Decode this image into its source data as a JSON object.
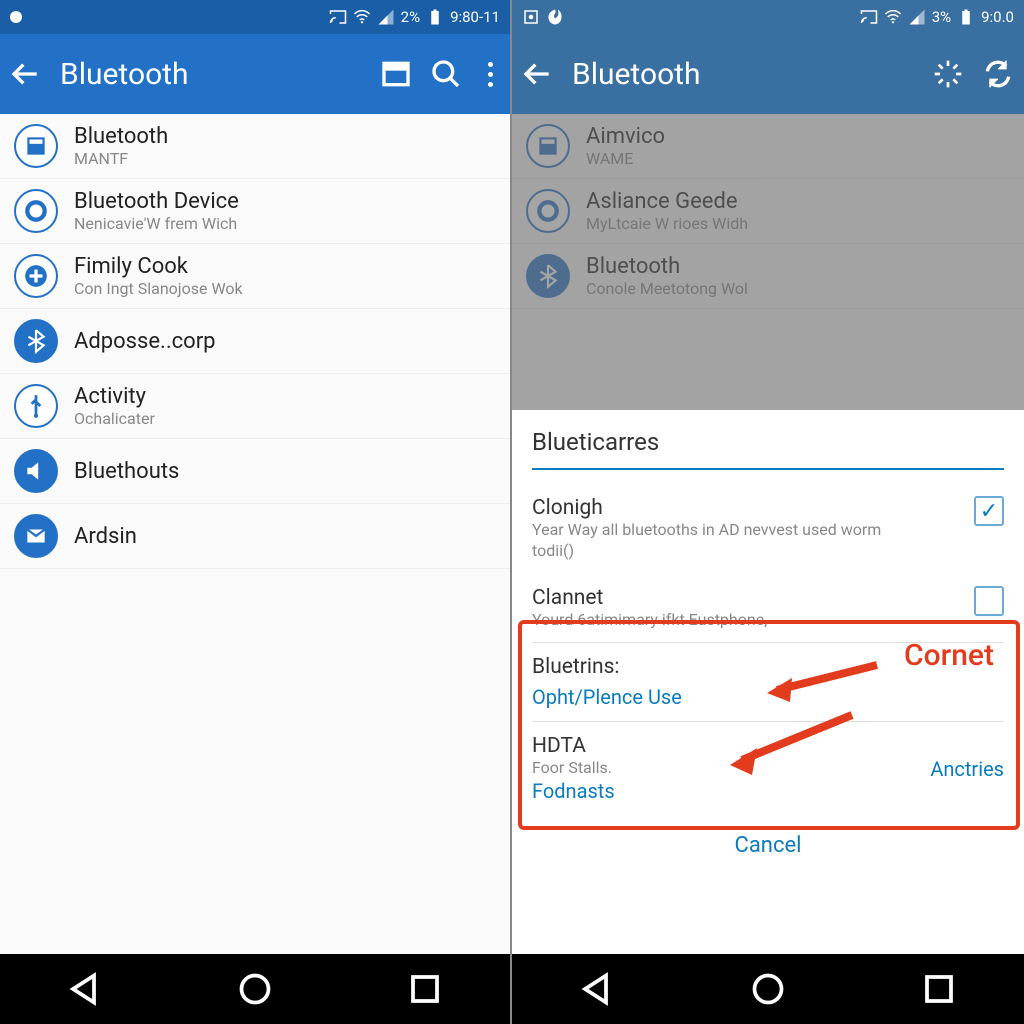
{
  "left": {
    "status": {
      "carrier_pct": "2%",
      "time": "9:80-11"
    },
    "appbar": {
      "title": "Bluetooth"
    },
    "items": [
      {
        "title": "Bluetooth",
        "sub": "MANTF",
        "icon": "window"
      },
      {
        "title": "Bluetooth Device",
        "sub": "Nenicavie'W frem Wich",
        "icon": "ring"
      },
      {
        "title": "Fimily Cook",
        "sub": "Con Ingt Slanojose Wok",
        "icon": "plus"
      },
      {
        "title": "Adposse..corp",
        "sub": "",
        "icon": "bt"
      },
      {
        "title": "Activity",
        "sub": "Ochalicater",
        "icon": "usb"
      },
      {
        "title": "Bluethouts",
        "sub": "",
        "icon": "speaker"
      },
      {
        "title": "Ardsin",
        "sub": "",
        "icon": "mail"
      }
    ]
  },
  "right": {
    "status": {
      "carrier_pct": "3%",
      "time": "9:0.0"
    },
    "appbar": {
      "title": "Bluetooth"
    },
    "items_bg": [
      {
        "title": "Aimvico",
        "sub": "WAME",
        "icon": "window"
      },
      {
        "title": "Asliance Geede",
        "sub": "MyLtcaie W rioes Widh",
        "icon": "ring"
      },
      {
        "title": "Bluetooth",
        "sub": "Conole Meetotong Wol",
        "icon": "bt"
      }
    ],
    "sheet": {
      "title": "Blueticarres",
      "opt1": {
        "title": "Clonigh",
        "sub": "Year Way all bluetooths in AD nevvest used worm todii()",
        "checked": true
      },
      "opt2": {
        "title": "Clannet",
        "sub": "Yourd 6atimimary ifkt Eustphone,",
        "checked": false
      },
      "sec1": {
        "title": "Bluetrins:",
        "link": "Opht/Plence Use"
      },
      "sec2": {
        "title": "HDTA",
        "sub": "Foor Stalls.",
        "link": "Fodnasts",
        "action": "Anctries"
      },
      "cancel": "Cancel"
    },
    "annotation": "Cornet"
  },
  "colors": {
    "accent": "#2371c7",
    "link": "#0a7bbd",
    "danger": "#e23b1e"
  }
}
